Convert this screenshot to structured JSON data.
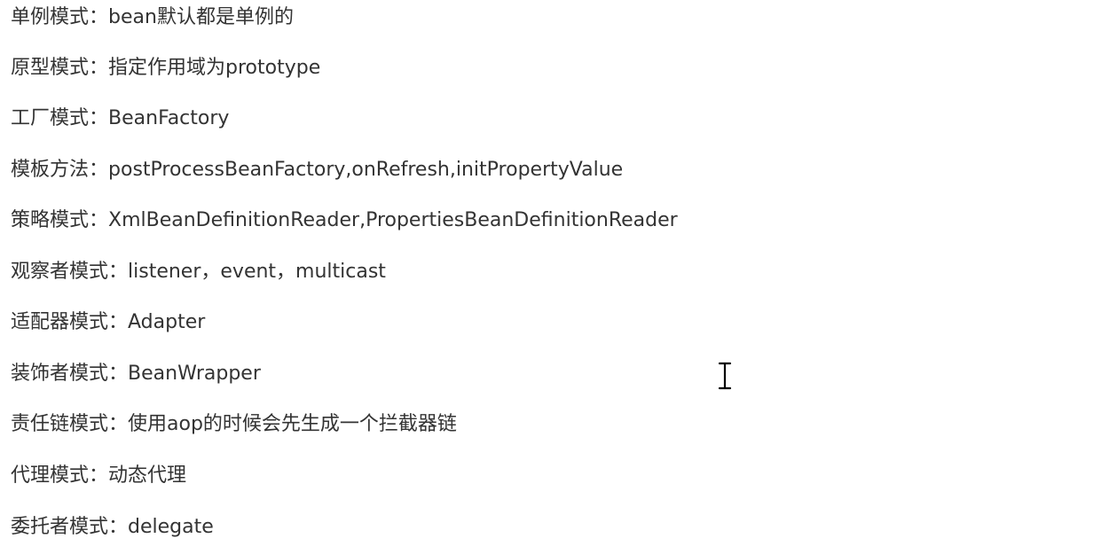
{
  "document": {
    "lines": [
      {
        "label": "单例模式：",
        "value": "bean默认都是单例的"
      },
      {
        "label": "原型模式：",
        "value": "指定作用域为prototype"
      },
      {
        "label": "工厂模式：",
        "value": "BeanFactory"
      },
      {
        "label": "模板方法：",
        "value": "postProcessBeanFactory,onRefresh,initPropertyValue"
      },
      {
        "label": "策略模式：",
        "value": "XmlBeanDefinitionReader,PropertiesBeanDefinitionReader"
      },
      {
        "label": "观察者模式：",
        "value": "listener，event，multicast"
      },
      {
        "label": "适配器模式：",
        "value": "Adapter"
      },
      {
        "label": "装饰者模式：",
        "value": "BeanWrapper"
      },
      {
        "label": "责任链模式：",
        "value": "使用aop的时候会先生成一个拦截器链"
      },
      {
        "label": "代理模式：",
        "value": "动态代理"
      },
      {
        "label": "委托者模式：",
        "value": "delegate"
      }
    ]
  },
  "cursor": {
    "icon": "text-cursor-icon"
  }
}
